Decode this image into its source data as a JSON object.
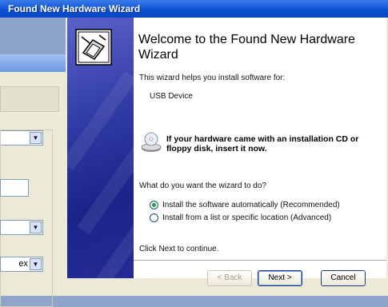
{
  "window": {
    "title": "Found New Hardware Wizard"
  },
  "wizard": {
    "heading": "Welcome to the Found New Hardware Wizard",
    "intro": "This wizard helps you install software for:",
    "device": "USB Device",
    "cd_notice": "If your hardware came with an installation CD or floppy disk, insert it now.",
    "question": "What do you want the wizard to do?",
    "options": [
      {
        "label": "Install the software automatically (Recommended)",
        "selected": true
      },
      {
        "label": "Install from a list or specific location (Advanced)",
        "selected": false
      }
    ],
    "continue_text": "Click Next to continue."
  },
  "buttons": {
    "back": "< Back",
    "next": "Next >",
    "cancel": "Cancel"
  },
  "background_dialog": {
    "partial_text": "ex"
  },
  "icons": {
    "hardware": "hardware-wizard-icon",
    "cd": "cd-icon",
    "dropdown": "chevron-down-icon"
  },
  "colors": {
    "titlebar": "#0a4fd3",
    "banner": "#2f3aa4",
    "radio_selected": "#22a33a"
  }
}
